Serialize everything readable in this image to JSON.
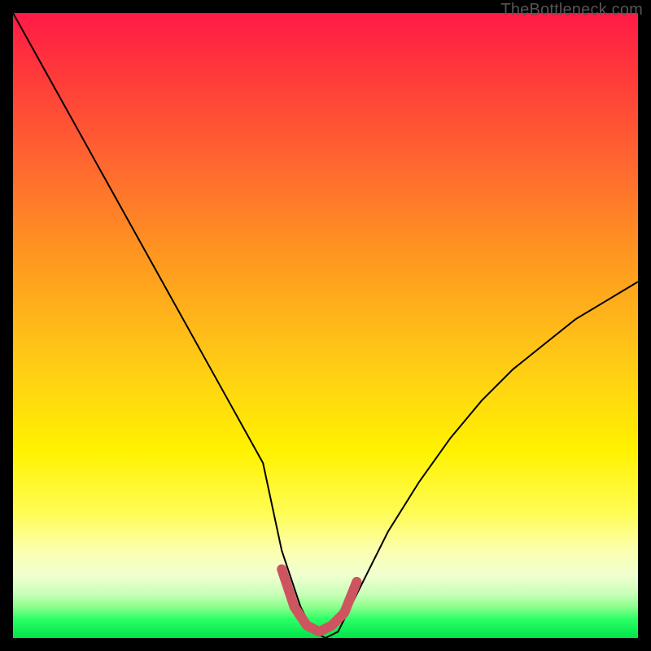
{
  "watermark": "TheBottleneck.com",
  "chart_data": {
    "type": "line",
    "title": "",
    "xlabel": "",
    "ylabel": "",
    "xlim": [
      0,
      100
    ],
    "ylim": [
      0,
      100
    ],
    "grid": false,
    "background": "rainbow-gradient-red-to-green",
    "series": [
      {
        "name": "bottleneck-curve",
        "color": "#000000",
        "stroke_width": 2,
        "x": [
          0,
          5,
          10,
          15,
          20,
          25,
          30,
          35,
          40,
          43,
          46,
          48,
          50,
          52,
          55,
          60,
          65,
          70,
          75,
          80,
          85,
          90,
          95,
          100
        ],
        "values": [
          100,
          91,
          82,
          73,
          64,
          55,
          46,
          37,
          28,
          14,
          5,
          1,
          0,
          1,
          7,
          17,
          25,
          32,
          38,
          43,
          47,
          51,
          54,
          57
        ]
      },
      {
        "name": "optimal-zone",
        "color": "#cc5560",
        "stroke_width": 12,
        "linecap": "round",
        "x": [
          43,
          45,
          47,
          49,
          51,
          53,
          55
        ],
        "values": [
          11,
          5,
          2,
          1,
          2,
          4,
          9
        ]
      }
    ]
  }
}
